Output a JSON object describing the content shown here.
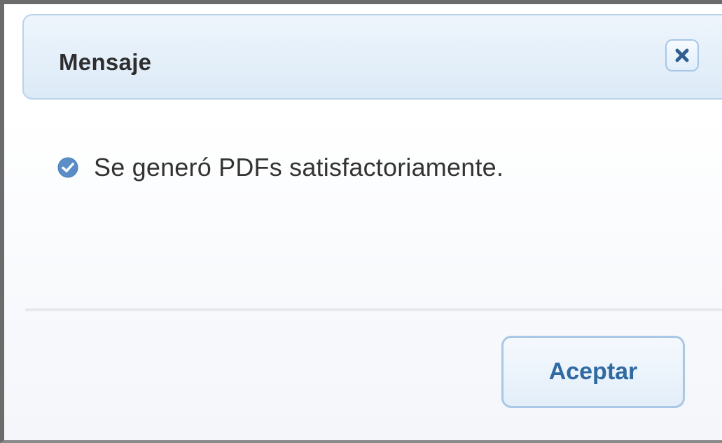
{
  "dialog": {
    "title": "Mensaje",
    "close_icon": "close-icon",
    "message": {
      "icon": "check-circle-icon",
      "text": "Se generó PDFs satisfactoriamente."
    },
    "accept_label": "Aceptar"
  },
  "colors": {
    "titlebar_border": "#b9d3ea",
    "titlebar_bg": "#dceaf7",
    "accent_text": "#2f6aa3",
    "check_icon": "#5b8ec6"
  }
}
